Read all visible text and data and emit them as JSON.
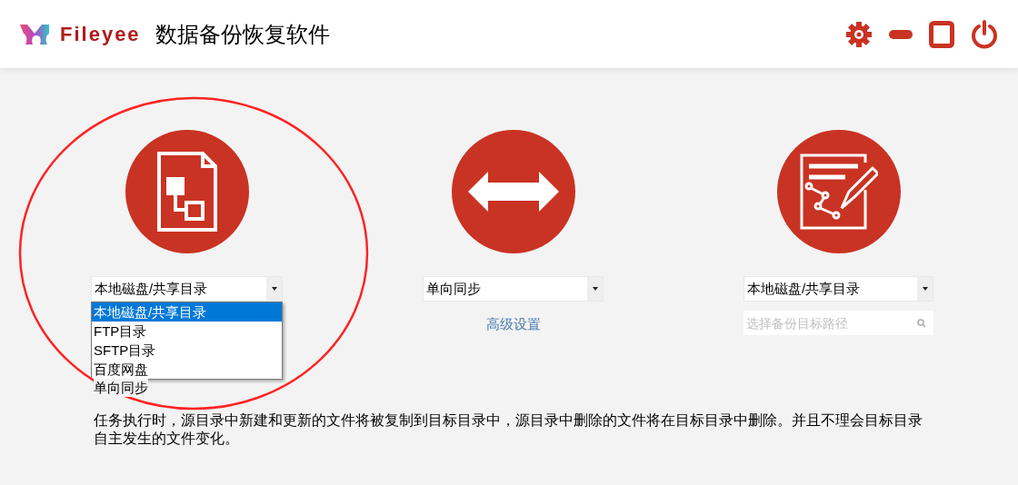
{
  "app": {
    "brand": "Fileyee",
    "title": "数据备份恢复软件"
  },
  "source": {
    "select": "本地磁盘/共享目录",
    "dropdown_open": true,
    "options": [
      {
        "label": "本地磁盘/共享目录",
        "selected": true
      },
      {
        "label": "FTP目录",
        "selected": false
      },
      {
        "label": "SFTP目录",
        "selected": false
      },
      {
        "label": "百度网盘",
        "selected": false
      }
    ]
  },
  "mode": {
    "select": "单向同步",
    "link": "高级设置"
  },
  "target": {
    "select": "本地磁盘/共享目录",
    "path_placeholder": "选择备份目标路径"
  },
  "description": {
    "title": "单向同步",
    "text": "任务执行时，源目录中新建和更新的文件将被复制到目标目录中，源目录中删除的文件将在目标目录中删除。并且不理会目标目录自主发生的文件变化。"
  }
}
